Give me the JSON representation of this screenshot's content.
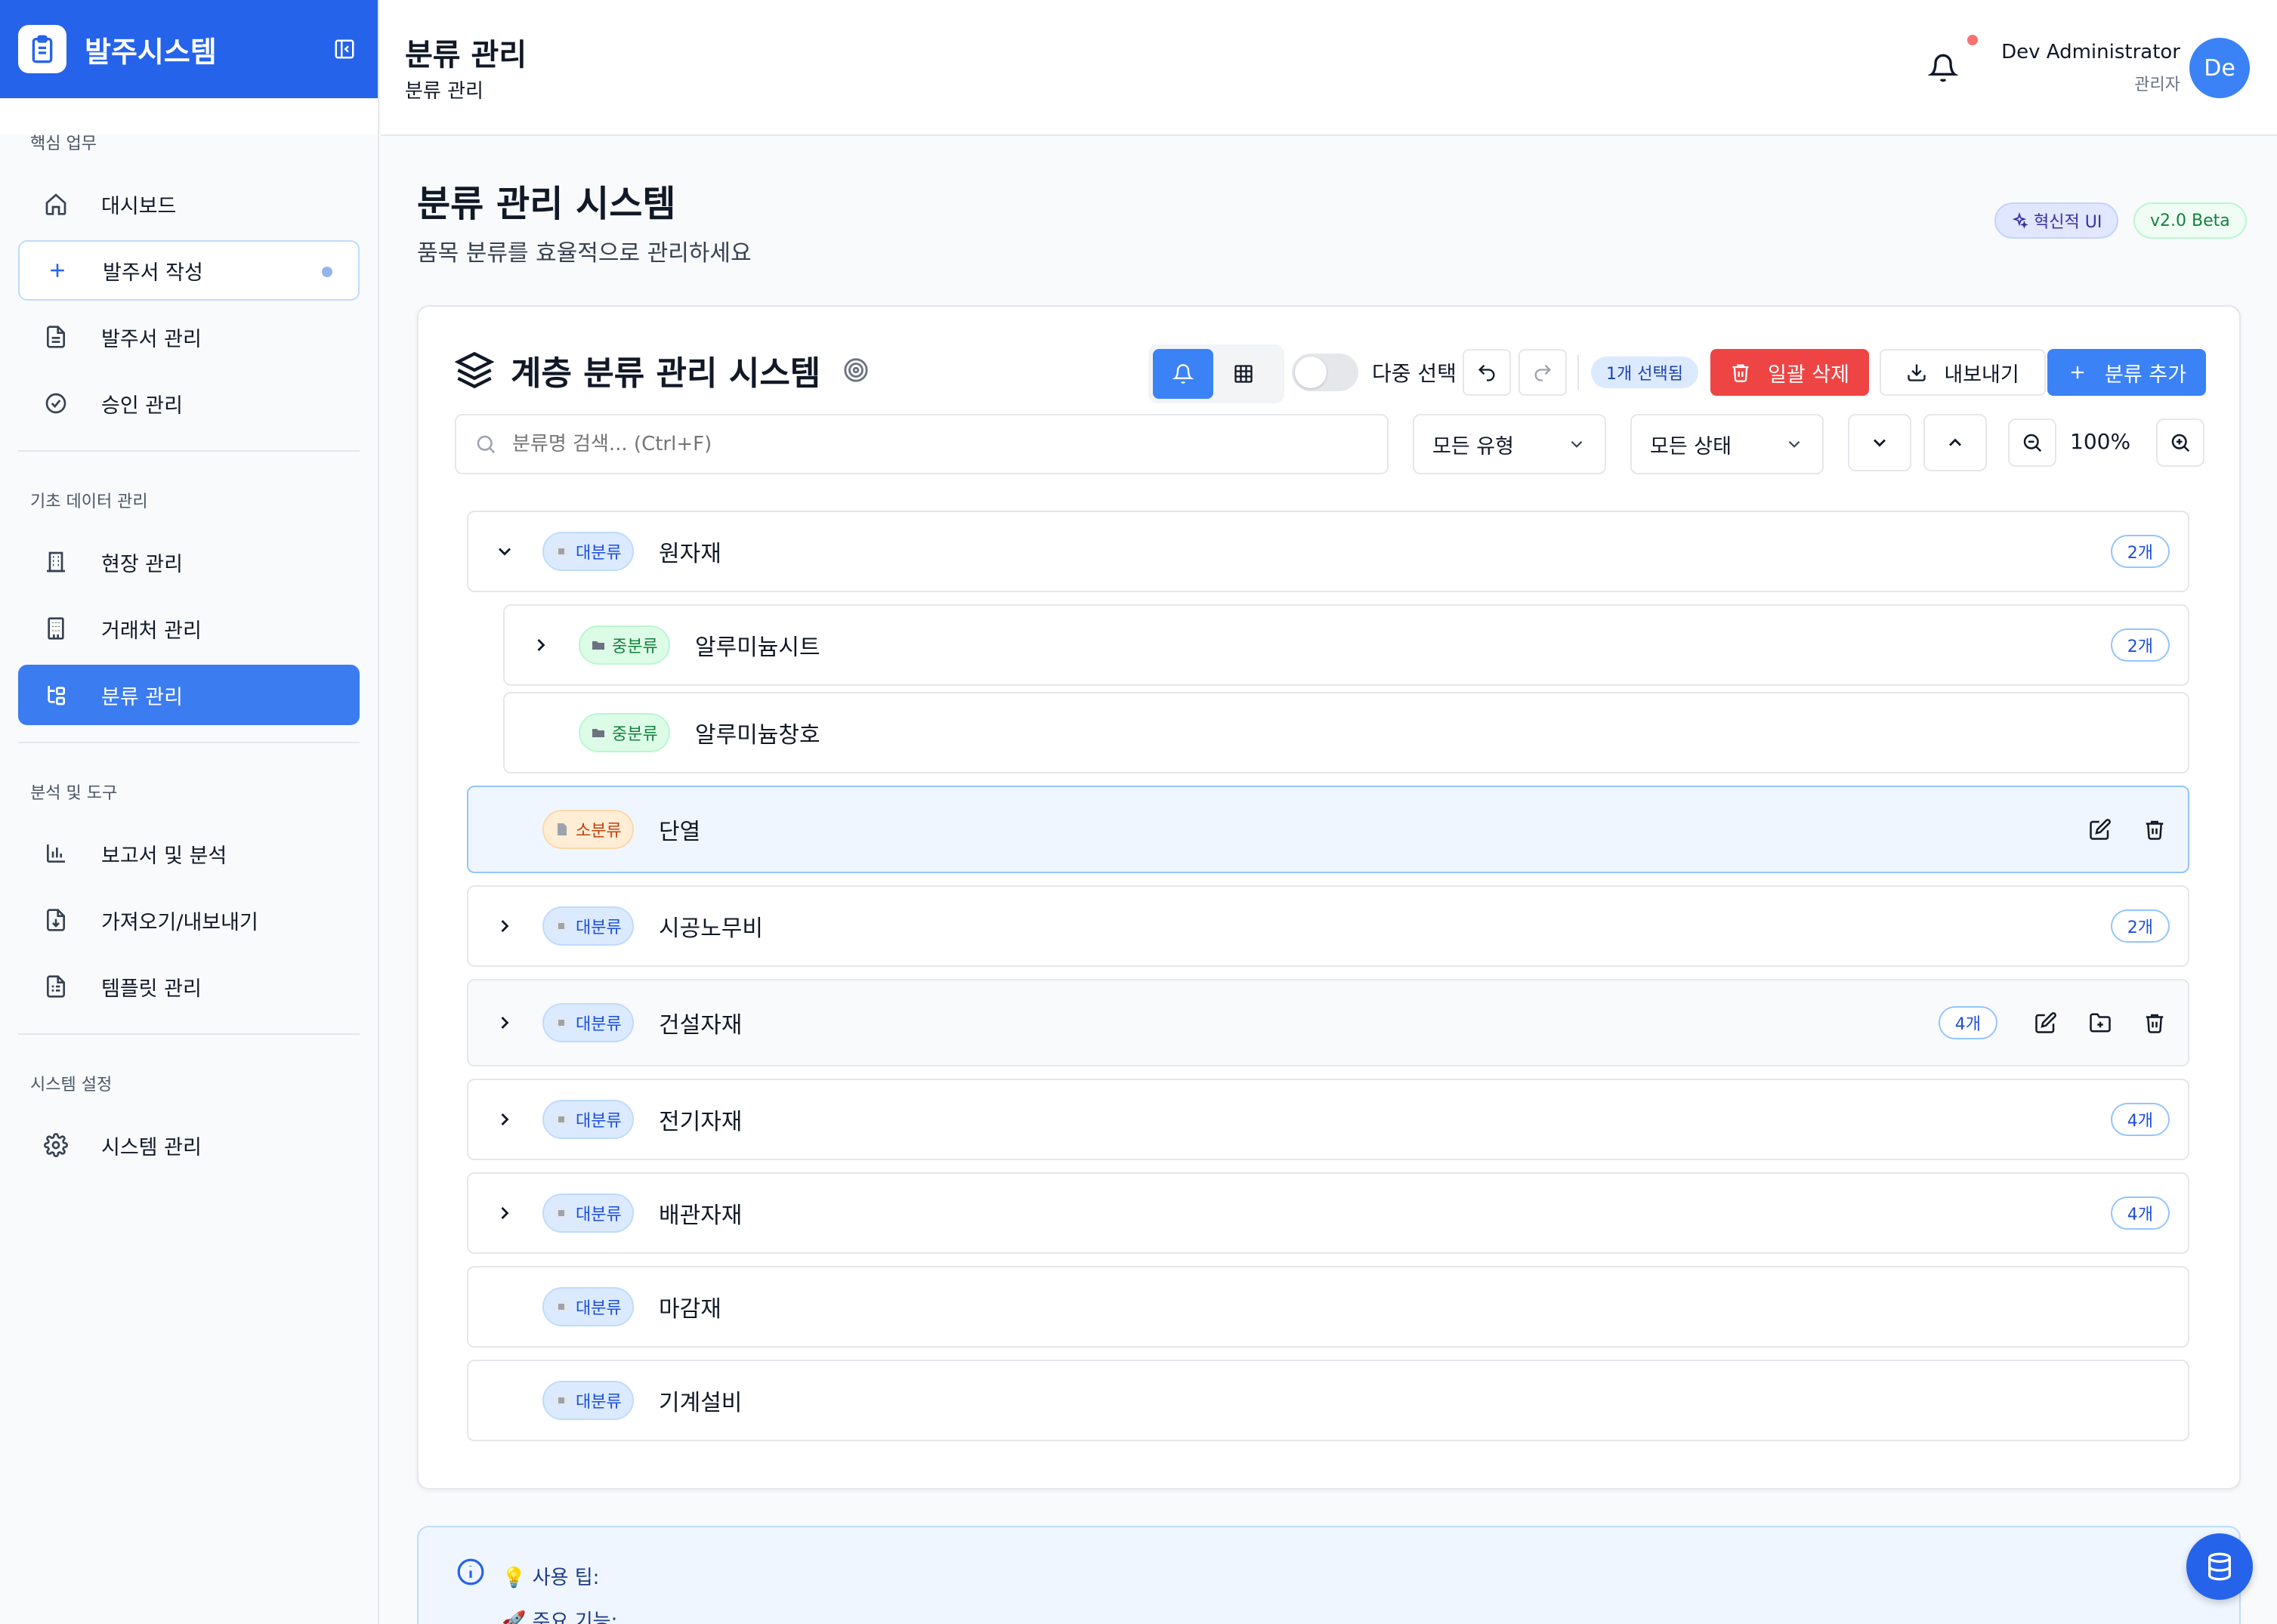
{
  "app": {
    "title": "발주시스템"
  },
  "sidebar": {
    "sections": [
      {
        "label": "핵심 업무",
        "items": [
          {
            "label": "대시보드",
            "icon": "home-icon"
          },
          {
            "label": "발주서 작성",
            "icon": "plus-icon"
          },
          {
            "label": "발주서 관리",
            "icon": "document-icon"
          },
          {
            "label": "승인 관리",
            "icon": "check-circle-icon"
          }
        ]
      },
      {
        "label": "기초 데이터 관리",
        "items": [
          {
            "label": "현장 관리",
            "icon": "building-icon"
          },
          {
            "label": "거래처 관리",
            "icon": "office-icon"
          },
          {
            "label": "분류 관리",
            "icon": "tree-icon"
          }
        ]
      },
      {
        "label": "분석 및 도구",
        "items": [
          {
            "label": "보고서 및 분석",
            "icon": "bar-chart-icon"
          },
          {
            "label": "가져오기/내보내기",
            "icon": "file-download-icon"
          },
          {
            "label": "템플릿 관리",
            "icon": "template-icon"
          }
        ]
      },
      {
        "label": "시스템 설정",
        "items": [
          {
            "label": "시스템 관리",
            "icon": "gear-icon"
          }
        ]
      }
    ]
  },
  "header": {
    "title": "분류 관리",
    "breadcrumb": "분류 관리",
    "user": {
      "name": "Dev Administrator",
      "role": "관리자",
      "initials": "De"
    }
  },
  "page": {
    "title": "분류 관리 시스템",
    "subtitle": "품목 분류를 효율적으로 관리하세요",
    "badges": {
      "ui": "혁신적 UI",
      "version": "v2.0 Beta"
    }
  },
  "tree_panel": {
    "title": "계층 분류 관리 시스템",
    "toolbar": {
      "multi_select_label": "다중 선택",
      "selected_count": "1개 선택됨",
      "bulk_delete": "일괄 삭제",
      "export": "내보내기",
      "add_category": "분류 추가"
    },
    "search_placeholder": "분류명 검색... (Ctrl+F)",
    "filters": {
      "type": "모든 유형",
      "status": "모든 상태"
    },
    "zoom": "100%",
    "rows": [
      {
        "type": "대분류",
        "name": "원자재",
        "count": "2개"
      },
      {
        "type": "중분류",
        "name": "알루미늄시트",
        "count": "2개"
      },
      {
        "type": "중분류",
        "name": "알루미늄창호",
        "count": ""
      },
      {
        "type": "소분류",
        "name": "단열",
        "count": ""
      },
      {
        "type": "대분류",
        "name": "시공노무비",
        "count": "2개"
      },
      {
        "type": "대분류",
        "name": "건설자재",
        "count": "4개"
      },
      {
        "type": "대분류",
        "name": "전기자재",
        "count": "4개"
      },
      {
        "type": "대분류",
        "name": "배관자재",
        "count": "4개"
      },
      {
        "type": "대분류",
        "name": "마감재",
        "count": ""
      },
      {
        "type": "대분류",
        "name": "기계설비",
        "count": ""
      }
    ]
  },
  "tips": {
    "title": "💡 사용 팁:",
    "features": "🚀 주요 기능:"
  },
  "colors": {
    "primary": "#2563eb",
    "danger": "#ef4444",
    "major": "#dbeafe",
    "mid": "#dcfce7",
    "minor": "#ffedd5"
  }
}
